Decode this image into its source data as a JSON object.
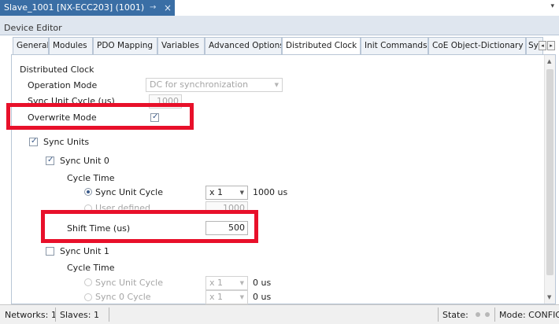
{
  "window": {
    "doc_tab_title": "Slave_1001 [NX-ECC203] (1001)",
    "pin_glyph": "→",
    "close_glyph": "×",
    "menu_glyph": "▾"
  },
  "editor": {
    "label": "Device Editor"
  },
  "tabs": {
    "general": "General",
    "modules": "Modules",
    "pdo_mapping": "PDO Mapping",
    "variables": "Variables",
    "advanced_options": "Advanced Options",
    "distributed_clock": "Distributed Clock",
    "init_commands": "Init Commands",
    "coe_object_dictionary": "CoE Object-Dictionary",
    "sync_truncated": "Sync",
    "scroll_left": "◂",
    "scroll_right": "▸",
    "active": "distributed_clock"
  },
  "dc": {
    "section_title": "Distributed Clock",
    "operation_mode_label": "Operation Mode",
    "operation_mode_value": "DC for synchronization",
    "sync_unit_cycle_label": "Sync Unit Cycle (us)",
    "sync_unit_cycle_value": "1000",
    "overwrite_mode_label": "Overwrite Mode",
    "overwrite_mode_checked": true,
    "sync_units_label": "Sync Units",
    "sync_units_checked": true,
    "sync_unit0": {
      "label": "Sync Unit 0",
      "checked": true,
      "cycle_time_label": "Cycle Time",
      "radio_sync_unit_cycle": "Sync Unit Cycle",
      "radio_user_defined": "User defined",
      "multiplier_value": "x 1",
      "cycle_result": "1000 us",
      "user_defined_value": "1000",
      "shift_time_label": "Shift Time (us)",
      "shift_time_value": "500"
    },
    "sync_unit1": {
      "label": "Sync Unit 1",
      "checked": false,
      "cycle_time_label": "Cycle Time",
      "radio_sync_unit_cycle": "Sync Unit Cycle",
      "radio_sync0_cycle": "Sync 0 Cycle",
      "multiplier1_value": "x 1",
      "result1": "0 us",
      "multiplier2_value": "x 1",
      "result2": "0 us"
    },
    "checkmark": "✓",
    "dropdown_arrow": "▼"
  },
  "scrollbar": {
    "up": "▲",
    "down": "▼"
  },
  "highlight_color": "#e8102a",
  "status": {
    "networks": "Networks: 1",
    "slaves": "Slaves: 1",
    "state": "State:",
    "mode": "Mode: CONFIG"
  },
  "colors": {
    "doc_tab_bg": "#3a6ea5",
    "header_bg": "#dfe6ef",
    "status_bg": "#f0f0f0"
  }
}
